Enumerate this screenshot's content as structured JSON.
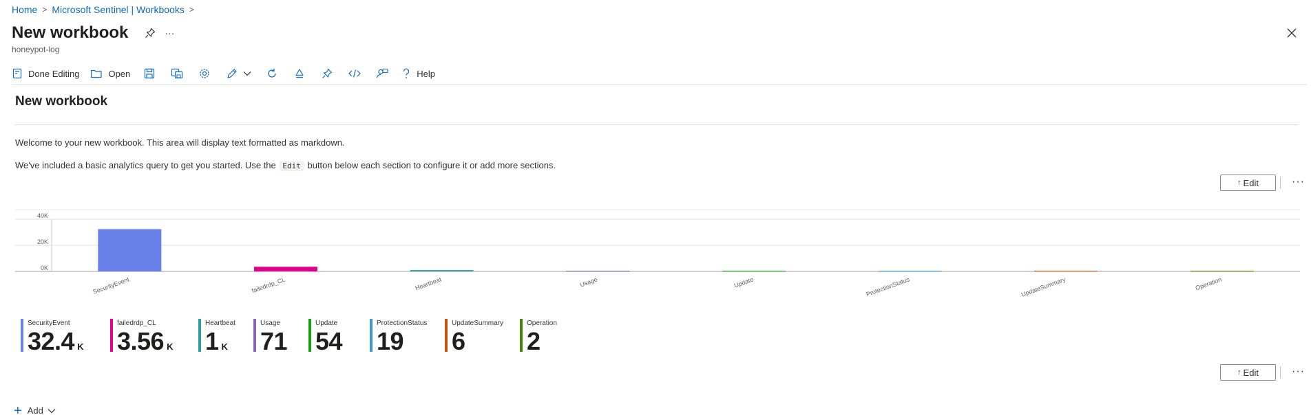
{
  "breadcrumb": {
    "home": "Home",
    "parent": "Microsoft Sentinel | Workbooks"
  },
  "header": {
    "title": "New workbook",
    "subtitle": "honeypot-log",
    "more": "···"
  },
  "toolbar": {
    "done_editing": "Done Editing",
    "open": "Open",
    "help": "Help"
  },
  "workbook": {
    "title": "New workbook",
    "text_p1": "Welcome to your new workbook. This area will display text formatted as markdown.",
    "text_p2_before": "We've included a basic analytics query to get you started. Use the",
    "text_p2_code": "Edit",
    "text_p2_after": "button below each section to configure it or add more sections.",
    "edit_label": "Edit",
    "edit_arrow": "↑",
    "more": "···",
    "add_label": "Add"
  },
  "chart_data": {
    "type": "bar",
    "categories": [
      "SecurityEvent",
      "failedrdp_CL",
      "Heartbeat",
      "Usage",
      "Update",
      "ProtectionStatus",
      "UpdateSummary",
      "Operation"
    ],
    "values": [
      32400,
      3560,
      1000,
      71,
      54,
      19,
      6,
      2
    ],
    "colors": [
      "#6881ea",
      "#e3008c",
      "#2aa0a4",
      "#8764b8",
      "#13a10e",
      "#3a96dd",
      "#ca5010",
      "#498205"
    ],
    "y_ticks": [
      "0K",
      "20K",
      "40K"
    ],
    "ylim": [
      0,
      40000
    ],
    "grid": true
  },
  "tiles": [
    {
      "label": "SecurityEvent",
      "num": "32.4",
      "unit": "K",
      "color": "#6881ea"
    },
    {
      "label": "failedrdp_CL",
      "num": "3.56",
      "unit": "K",
      "color": "#e3008c"
    },
    {
      "label": "Heartbeat",
      "num": "1",
      "unit": "K",
      "color": "#2aa0a4"
    },
    {
      "label": "Usage",
      "num": "71",
      "unit": "",
      "color": "#8764b8"
    },
    {
      "label": "Update",
      "num": "54",
      "unit": "",
      "color": "#13a10e"
    },
    {
      "label": "ProtectionStatus",
      "num": "19",
      "unit": "",
      "color": "#3a96dd"
    },
    {
      "label": "UpdateSummary",
      "num": "6",
      "unit": "",
      "color": "#ca5010"
    },
    {
      "label": "Operation",
      "num": "2",
      "unit": "",
      "color": "#498205"
    }
  ]
}
